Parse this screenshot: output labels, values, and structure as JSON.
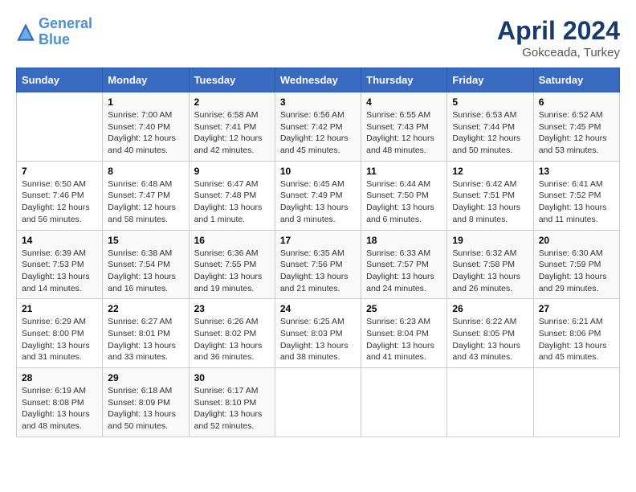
{
  "header": {
    "logo_line1": "General",
    "logo_line2": "Blue",
    "month": "April 2024",
    "location": "Gokceada, Turkey"
  },
  "columns": [
    "Sunday",
    "Monday",
    "Tuesday",
    "Wednesday",
    "Thursday",
    "Friday",
    "Saturday"
  ],
  "weeks": [
    [
      {
        "day": "",
        "detail": ""
      },
      {
        "day": "1",
        "detail": "Sunrise: 7:00 AM\nSunset: 7:40 PM\nDaylight: 12 hours\nand 40 minutes."
      },
      {
        "day": "2",
        "detail": "Sunrise: 6:58 AM\nSunset: 7:41 PM\nDaylight: 12 hours\nand 42 minutes."
      },
      {
        "day": "3",
        "detail": "Sunrise: 6:56 AM\nSunset: 7:42 PM\nDaylight: 12 hours\nand 45 minutes."
      },
      {
        "day": "4",
        "detail": "Sunrise: 6:55 AM\nSunset: 7:43 PM\nDaylight: 12 hours\nand 48 minutes."
      },
      {
        "day": "5",
        "detail": "Sunrise: 6:53 AM\nSunset: 7:44 PM\nDaylight: 12 hours\nand 50 minutes."
      },
      {
        "day": "6",
        "detail": "Sunrise: 6:52 AM\nSunset: 7:45 PM\nDaylight: 12 hours\nand 53 minutes."
      }
    ],
    [
      {
        "day": "7",
        "detail": "Sunrise: 6:50 AM\nSunset: 7:46 PM\nDaylight: 12 hours\nand 56 minutes."
      },
      {
        "day": "8",
        "detail": "Sunrise: 6:48 AM\nSunset: 7:47 PM\nDaylight: 12 hours\nand 58 minutes."
      },
      {
        "day": "9",
        "detail": "Sunrise: 6:47 AM\nSunset: 7:48 PM\nDaylight: 13 hours\nand 1 minute."
      },
      {
        "day": "10",
        "detail": "Sunrise: 6:45 AM\nSunset: 7:49 PM\nDaylight: 13 hours\nand 3 minutes."
      },
      {
        "day": "11",
        "detail": "Sunrise: 6:44 AM\nSunset: 7:50 PM\nDaylight: 13 hours\nand 6 minutes."
      },
      {
        "day": "12",
        "detail": "Sunrise: 6:42 AM\nSunset: 7:51 PM\nDaylight: 13 hours\nand 8 minutes."
      },
      {
        "day": "13",
        "detail": "Sunrise: 6:41 AM\nSunset: 7:52 PM\nDaylight: 13 hours\nand 11 minutes."
      }
    ],
    [
      {
        "day": "14",
        "detail": "Sunrise: 6:39 AM\nSunset: 7:53 PM\nDaylight: 13 hours\nand 14 minutes."
      },
      {
        "day": "15",
        "detail": "Sunrise: 6:38 AM\nSunset: 7:54 PM\nDaylight: 13 hours\nand 16 minutes."
      },
      {
        "day": "16",
        "detail": "Sunrise: 6:36 AM\nSunset: 7:55 PM\nDaylight: 13 hours\nand 19 minutes."
      },
      {
        "day": "17",
        "detail": "Sunrise: 6:35 AM\nSunset: 7:56 PM\nDaylight: 13 hours\nand 21 minutes."
      },
      {
        "day": "18",
        "detail": "Sunrise: 6:33 AM\nSunset: 7:57 PM\nDaylight: 13 hours\nand 24 minutes."
      },
      {
        "day": "19",
        "detail": "Sunrise: 6:32 AM\nSunset: 7:58 PM\nDaylight: 13 hours\nand 26 minutes."
      },
      {
        "day": "20",
        "detail": "Sunrise: 6:30 AM\nSunset: 7:59 PM\nDaylight: 13 hours\nand 29 minutes."
      }
    ],
    [
      {
        "day": "21",
        "detail": "Sunrise: 6:29 AM\nSunset: 8:00 PM\nDaylight: 13 hours\nand 31 minutes."
      },
      {
        "day": "22",
        "detail": "Sunrise: 6:27 AM\nSunset: 8:01 PM\nDaylight: 13 hours\nand 33 minutes."
      },
      {
        "day": "23",
        "detail": "Sunrise: 6:26 AM\nSunset: 8:02 PM\nDaylight: 13 hours\nand 36 minutes."
      },
      {
        "day": "24",
        "detail": "Sunrise: 6:25 AM\nSunset: 8:03 PM\nDaylight: 13 hours\nand 38 minutes."
      },
      {
        "day": "25",
        "detail": "Sunrise: 6:23 AM\nSunset: 8:04 PM\nDaylight: 13 hours\nand 41 minutes."
      },
      {
        "day": "26",
        "detail": "Sunrise: 6:22 AM\nSunset: 8:05 PM\nDaylight: 13 hours\nand 43 minutes."
      },
      {
        "day": "27",
        "detail": "Sunrise: 6:21 AM\nSunset: 8:06 PM\nDaylight: 13 hours\nand 45 minutes."
      }
    ],
    [
      {
        "day": "28",
        "detail": "Sunrise: 6:19 AM\nSunset: 8:08 PM\nDaylight: 13 hours\nand 48 minutes."
      },
      {
        "day": "29",
        "detail": "Sunrise: 6:18 AM\nSunset: 8:09 PM\nDaylight: 13 hours\nand 50 minutes."
      },
      {
        "day": "30",
        "detail": "Sunrise: 6:17 AM\nSunset: 8:10 PM\nDaylight: 13 hours\nand 52 minutes."
      },
      {
        "day": "",
        "detail": ""
      },
      {
        "day": "",
        "detail": ""
      },
      {
        "day": "",
        "detail": ""
      },
      {
        "day": "",
        "detail": ""
      }
    ]
  ]
}
